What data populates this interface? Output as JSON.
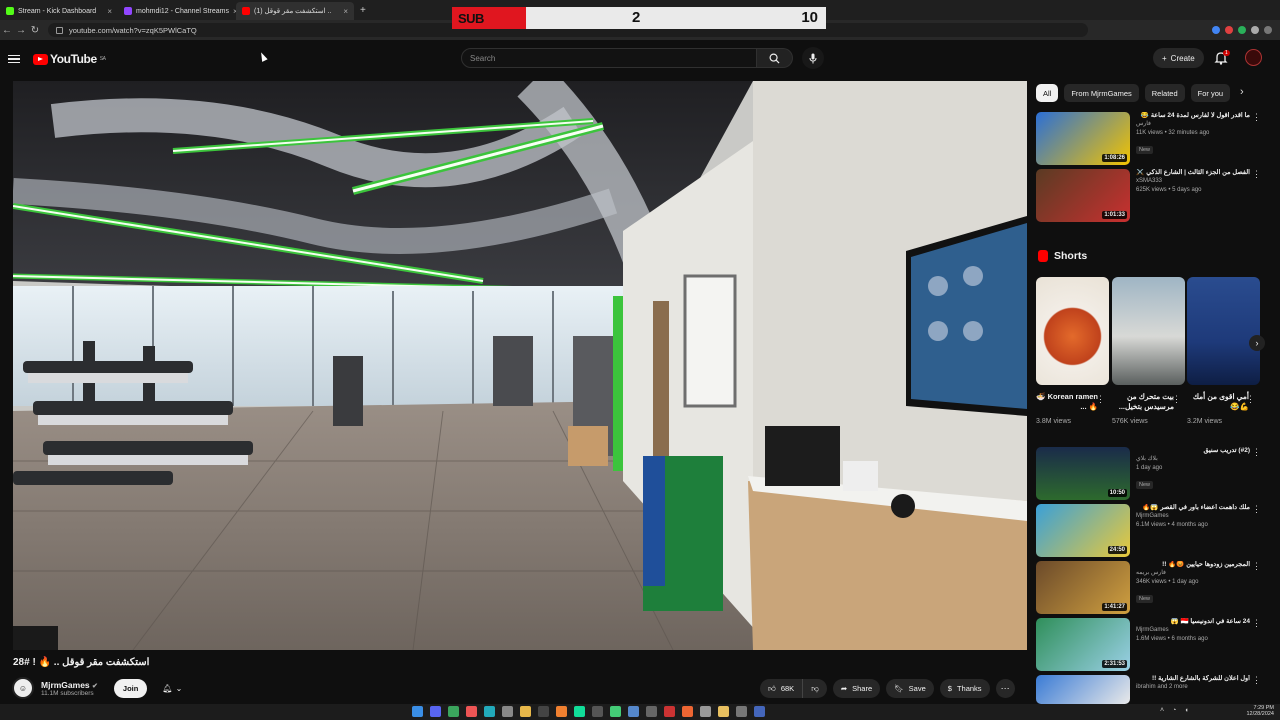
{
  "browser": {
    "tabs": [
      {
        "label": "Stream - Kick Dashboard",
        "color": "#53fc18"
      },
      {
        "label": "mohmdi12 - Channel Streams",
        "color": "#9146ff"
      },
      {
        "label": "(1) استكشفت مقر قوقل ..",
        "color": "#ff0000"
      }
    ],
    "url": "youtube.com/watch?v=zqK5PWlCaTQ"
  },
  "scoreboard": {
    "label": "SUB",
    "left_score": "2",
    "right_score": "10"
  },
  "youtube": {
    "logo_text": "YouTube",
    "region": "SA",
    "search_placeholder": "Search",
    "create_label": "Create",
    "notif_count": "1"
  },
  "video": {
    "title": "استكشفت مقر قوقل .. 🔥 ! #28",
    "channel": "MjrmGames",
    "subscribers": "11.1M subscribers",
    "join_label": "Join",
    "likes": "68K",
    "share_label": "Share",
    "save_label": "Save",
    "thanks_label": "Thanks"
  },
  "chips": [
    "All",
    "From MjrmGames",
    "Related",
    "For you"
  ],
  "recommendations_top": [
    {
      "title": "ما اقدر اقول لا لفارس لمدة 24 ساعة 😂",
      "channel": "فارس",
      "meta": "11K views • 32 minutes ago",
      "badge": "New",
      "duration": "1:08:26",
      "color": "#2b6fd6"
    },
    {
      "title": "الفصل من الجزء الثالث | الشارع الذكي ⚔️",
      "channel": "xSMA333",
      "meta": "625K views • 5 days ago",
      "badge": "",
      "duration": "1:01:33",
      "color": "#5a3b23"
    }
  ],
  "shorts": {
    "heading": "Shorts",
    "items": [
      {
        "title": "Korean ramen 🍜 🔥 ...",
        "views": "3.8M views",
        "color": "#d9532b"
      },
      {
        "title": "بيت متحرك من مرسيدس بتخيل...",
        "views": "576K views",
        "color": "#7f98a8"
      },
      {
        "title": "أمي اقوى من أمك 💪😂",
        "views": "3.2M views",
        "color": "#1e3a7a"
      }
    ]
  },
  "recommendations_bottom": [
    {
      "title": "(#2) تدريب سنيق",
      "channel": "بلاك بلاي",
      "meta": "1 day ago",
      "badge": "New",
      "duration": "10:50",
      "color": "#1a2b4a"
    },
    {
      "title": "ملك داهمت أعضاء باور في القصر 😱🔥",
      "channel": "MjrmGames",
      "meta": "6.1M views • 4 months ago",
      "badge": "",
      "duration": "24:50",
      "color": "#3aa0d8"
    },
    {
      "title": "المجرمين زودوها حيايين 😡🔥 !!",
      "channel": "فارس بريمه",
      "meta": "346K views • 1 day ago",
      "badge": "New",
      "duration": "1:41:27",
      "color": "#6b4a2a"
    },
    {
      "title": "24 ساعة في اندونيسيا 🇮🇩 😱",
      "channel": "MjrmGames",
      "meta": "1.6M views • 6 months ago",
      "badge": "",
      "duration": "2:31:53",
      "color": "#2f8f5a"
    },
    {
      "title": "أول اعلان للشركة بالشارع الشارية !!",
      "channel": "ibrahim",
      "meta": "and 2 more",
      "badge": "",
      "duration": "",
      "color": "#3a7bd5"
    }
  ],
  "taskbar": {
    "time": "7:29 PM",
    "date": "12/28/2024"
  }
}
